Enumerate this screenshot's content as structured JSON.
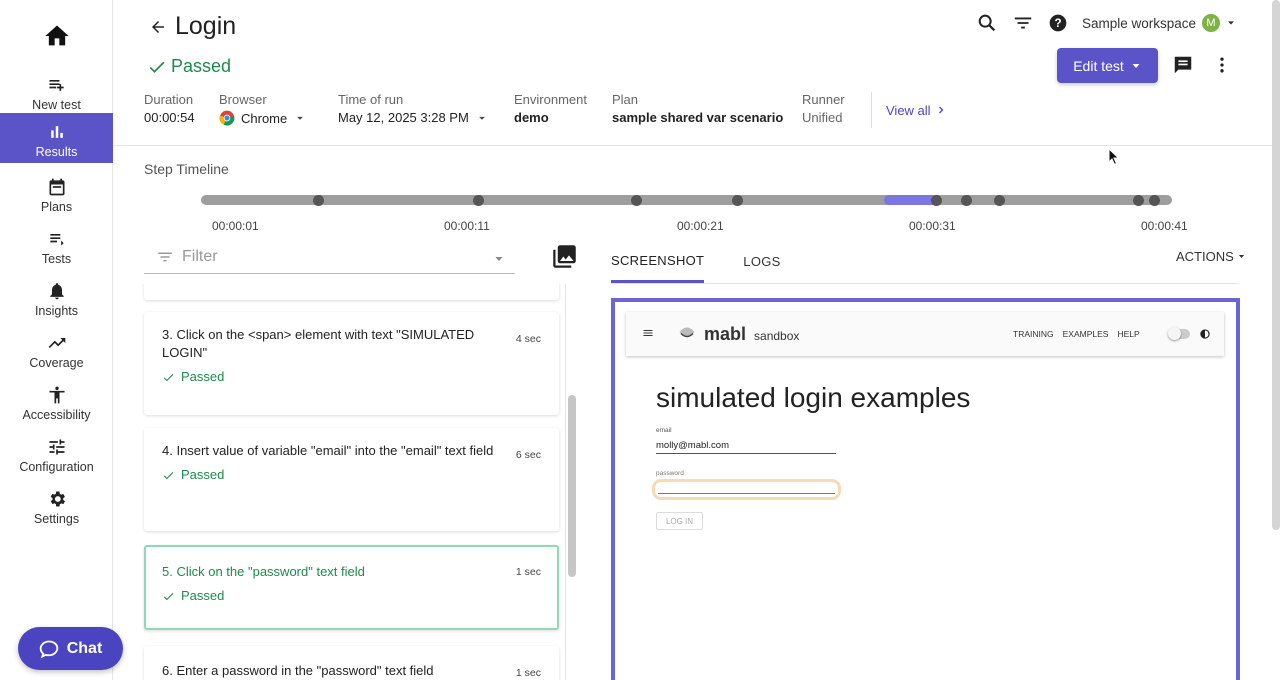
{
  "sidebar": {
    "home_icon": "home-icon",
    "items": [
      {
        "label": "New test",
        "icon": "playlist-add-icon"
      },
      {
        "label": "Results",
        "icon": "bar-chart-icon",
        "active": true
      },
      {
        "label": "Plans",
        "icon": "calendar-icon"
      },
      {
        "label": "Tests",
        "icon": "list-icon"
      },
      {
        "label": "Insights",
        "icon": "bell-icon"
      },
      {
        "label": "Coverage",
        "icon": "trending-up-icon"
      },
      {
        "label": "Accessibility",
        "icon": "accessibility-icon"
      },
      {
        "label": "Configuration",
        "icon": "sliders-icon"
      },
      {
        "label": "Settings",
        "icon": "gear-icon"
      }
    ],
    "chat_label": "Chat"
  },
  "header": {
    "title": "Login",
    "status": "Passed",
    "workspace": "Sample workspace",
    "avatar_initial": "M",
    "edit_button": "Edit test",
    "meta": {
      "duration_label": "Duration",
      "duration": "00:00:54",
      "browser_label": "Browser",
      "browser": "Chrome",
      "time_label": "Time of run",
      "time": "May 12, 2025 3:28 PM",
      "env_label": "Environment",
      "env": "demo",
      "plan_label": "Plan",
      "plan": "sample shared var scenario",
      "runner_label": "Runner",
      "runner": "Unified"
    },
    "view_all": "View all"
  },
  "timeline": {
    "title": "Step Timeline",
    "ticks": [
      "00:00:01",
      "00:00:11",
      "00:00:21",
      "00:00:31",
      "00:00:41"
    ]
  },
  "steps_panel": {
    "filter_placeholder": "Filter",
    "steps": [
      {
        "text": "3. Click on the <span> element with text \"SIMULATED LOGIN\"",
        "duration": "4 sec",
        "status": "Passed"
      },
      {
        "text": "4. Insert value of variable \"email\" into the \"email\" text field",
        "duration": "6 sec",
        "status": "Passed"
      },
      {
        "text": "5. Click on the \"password\" text field",
        "duration": "1 sec",
        "status": "Passed"
      },
      {
        "text": "6. Enter a password in the \"password\" text field",
        "duration": "1 sec"
      }
    ]
  },
  "right_panel": {
    "tabs": [
      "SCREENSHOT",
      "LOGS"
    ],
    "actions_label": "ACTIONS",
    "screenshot": {
      "brand": "mabl",
      "brand_sub": "sandbox",
      "links": [
        "TRAINING",
        "EXAMPLES",
        "HELP"
      ],
      "heading": "simulated login examples",
      "email_label": "email",
      "email_value": "molly@mabl.com",
      "password_label": "password",
      "login_button": "LOG IN"
    }
  },
  "colors": {
    "accent": "#5b54c9",
    "success": "#1f8a4c",
    "highlight": "#7c76e0"
  }
}
